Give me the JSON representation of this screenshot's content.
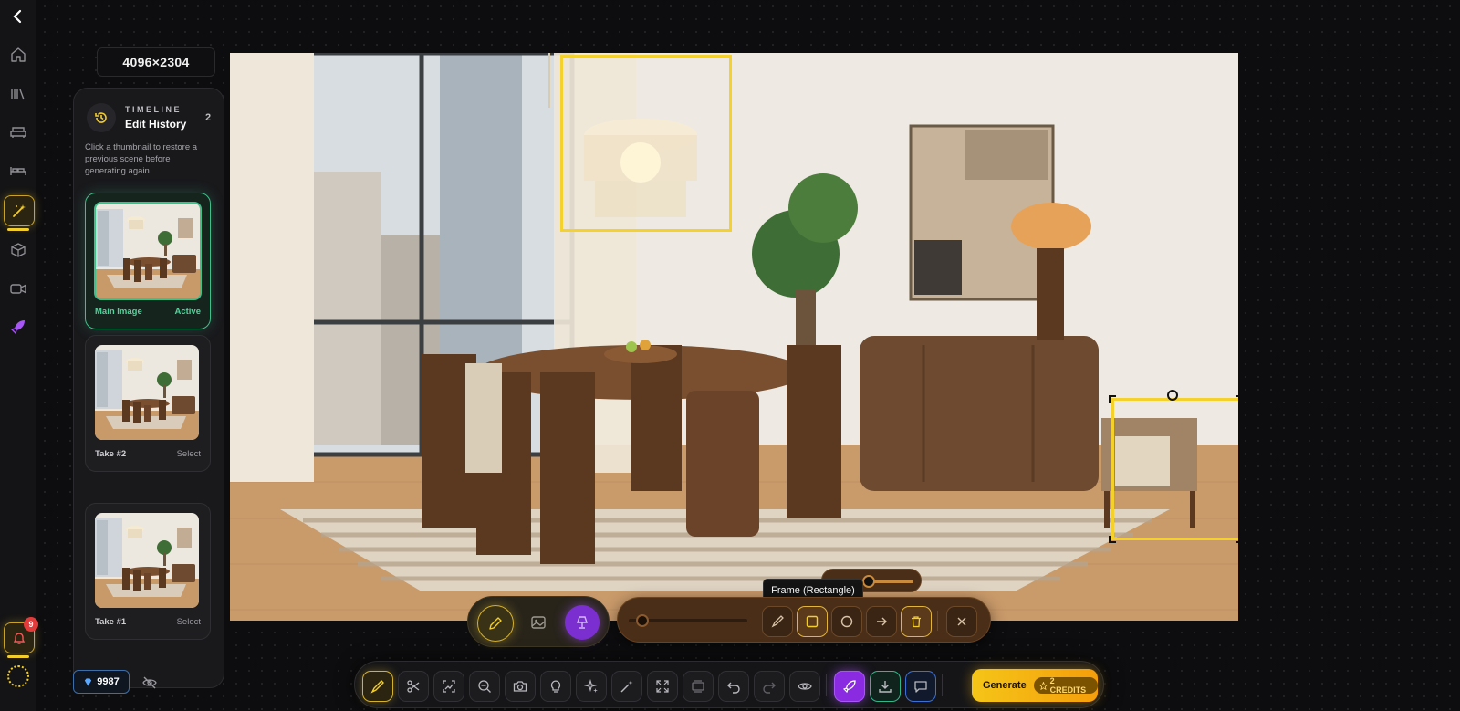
{
  "canvas": {
    "dimensions": "4096×2304"
  },
  "nav": {
    "items": [
      {
        "name": "back",
        "icon": "chevron-left-icon"
      },
      {
        "name": "home",
        "icon": "home-icon"
      },
      {
        "name": "library",
        "icon": "library-icon"
      },
      {
        "name": "furniture",
        "icon": "sofa-icon"
      },
      {
        "name": "bed",
        "icon": "bed-icon"
      },
      {
        "name": "magic",
        "icon": "magic-wand-icon",
        "active": true
      },
      {
        "name": "3d",
        "icon": "cube-icon"
      },
      {
        "name": "video",
        "icon": "video-icon"
      },
      {
        "name": "launch",
        "icon": "rocket-icon"
      }
    ],
    "notifications_count": "9"
  },
  "timeline": {
    "kicker": "TIMELINE",
    "title": "Edit History",
    "count": "2",
    "description": "Click a thumbnail to restore a previous scene before generating again.",
    "items": [
      {
        "label": "Main Image",
        "action": "Active",
        "active": true
      },
      {
        "label": "Take #2",
        "action": "Select",
        "active": false
      },
      {
        "label": "Take #1",
        "action": "Select",
        "active": false
      }
    ]
  },
  "credits": {
    "value": "9987"
  },
  "draw_tools": {
    "tooltip": "Frame (Rectangle)",
    "modes": [
      "pencil-icon",
      "image-icon",
      "lamp-icon"
    ],
    "shapes": [
      "brush-icon",
      "square-icon",
      "circle-icon",
      "arrow-right-icon",
      "trash-icon",
      "close-icon"
    ],
    "selected_shape": "square-icon"
  },
  "toolbar": {
    "tools": [
      "brush-icon",
      "scissors-icon",
      "image-edit-icon",
      "zoom-out-icon",
      "camera-icon",
      "lightbulb-icon",
      "sparkles-icon",
      "magic-wand-icon",
      "expand-icon",
      "layers-icon",
      "undo-icon",
      "redo-icon",
      "eye-icon",
      "rocket-icon",
      "download-icon",
      "chat-icon"
    ],
    "generate_label": "Generate",
    "generate_credits": "2 CREDITS"
  },
  "colors": {
    "accent": "#f4d12c",
    "active_green": "#3fbf8a",
    "rocket_purple": "#8a2be2",
    "shape_bar": "#4a2e18"
  }
}
